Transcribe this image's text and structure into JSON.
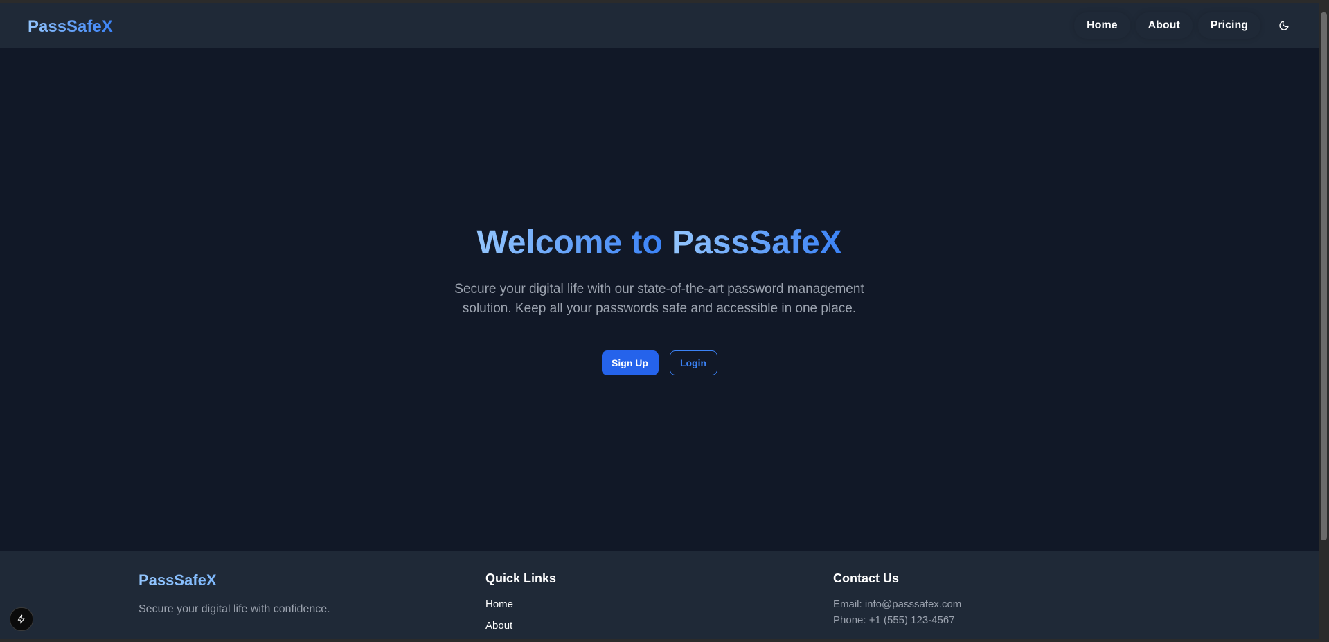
{
  "brand": {
    "name": "PassSafeX"
  },
  "nav": {
    "items": [
      {
        "label": "Home"
      },
      {
        "label": "About"
      },
      {
        "label": "Pricing"
      }
    ],
    "theme_icon": "moon-icon"
  },
  "hero": {
    "title_part1": "Welcome to",
    "title_part2": "PassSafeX",
    "subtitle": "Secure your digital life with our state-of-the-art password management solution. Keep all your passwords safe and accessible in one place.",
    "signup_label": "Sign Up",
    "login_label": "Login"
  },
  "footer": {
    "brand": "PassSafeX",
    "tagline": "Secure your digital life with confidence.",
    "quick_links_heading": "Quick Links",
    "quick_links": [
      {
        "label": "Home"
      },
      {
        "label": "About"
      }
    ],
    "contact_heading": "Contact Us",
    "email": "Email: info@passsafex.com",
    "phone": "Phone: +1 (555) 123-4567"
  },
  "dev_indicator_icon": "lightning-icon",
  "colors": {
    "background": "#111827",
    "surface": "#1f2937",
    "accent": "#3b82f6",
    "accent_light": "#93c5fd",
    "muted_text": "#9ca3af"
  }
}
